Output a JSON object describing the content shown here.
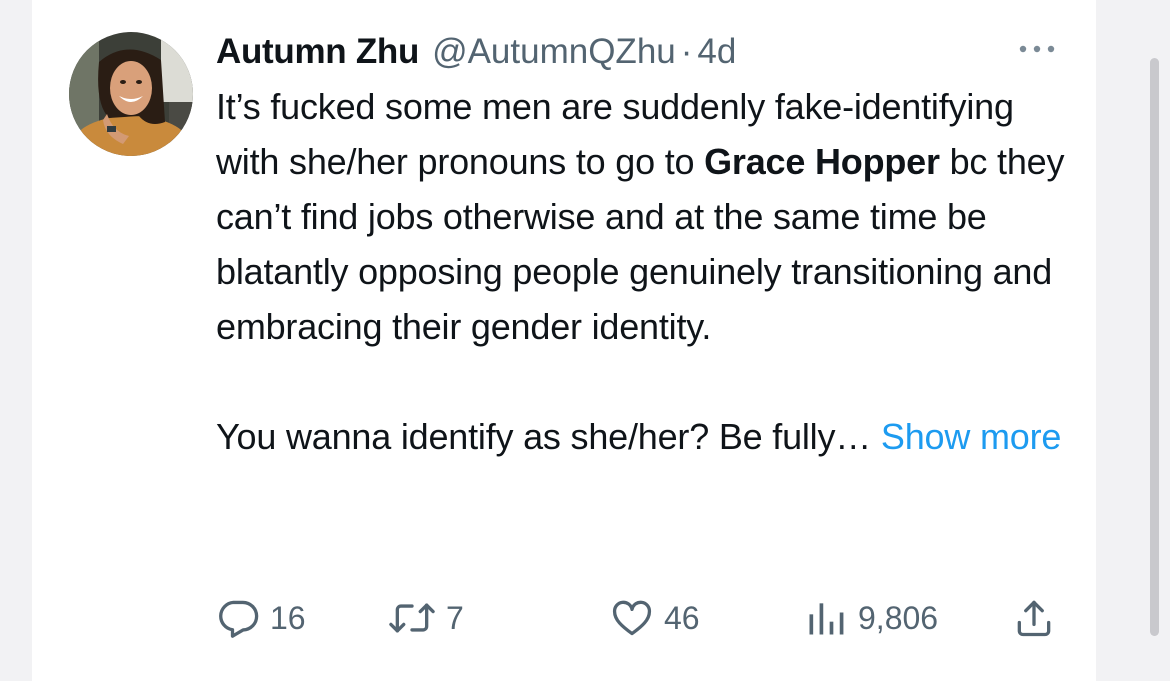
{
  "tweet": {
    "author_name": "Autumn Zhu",
    "author_handle": "@AutumnQZhu",
    "separator": "·",
    "time": "4d",
    "text_line_before": "It’s fucked some men are suddenly fake-identifying with she/her pronouns to go to ",
    "text_bold": "Grace Hopper",
    "text_line_after": " bc they can’t find jobs otherwise and at the same time be blatantly opposing people genuinely transitioning and embracing their gender identity.",
    "text_paragraph_2": "You wanna identify as she/her? Be fully…",
    "show_more_label": "Show more"
  },
  "actions": {
    "replies": "16",
    "retweets": "7",
    "likes": "46",
    "views": "9,806"
  },
  "icons": {
    "more": "more-horizontal-icon",
    "reply": "reply-bubble-icon",
    "retweet": "retweet-icon",
    "like": "heart-icon",
    "views": "bar-chart-icon",
    "share": "share-upload-icon"
  },
  "colors": {
    "text": "#0f1419",
    "secondary": "#536471",
    "link": "#1d9bf0",
    "background": "#ffffff"
  }
}
